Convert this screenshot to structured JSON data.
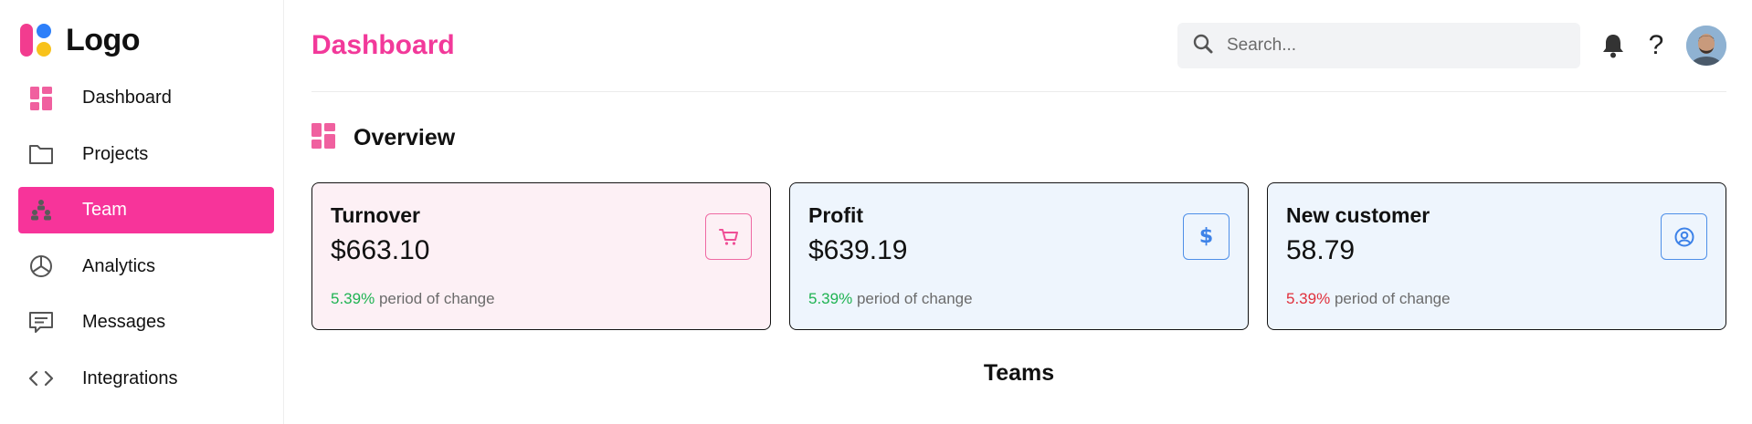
{
  "logo": {
    "text": "Logo"
  },
  "sidebar": {
    "items": [
      {
        "label": "Dashboard",
        "icon": "dashboard-icon",
        "active": false
      },
      {
        "label": "Projects",
        "icon": "folder-icon",
        "active": false
      },
      {
        "label": "Team",
        "icon": "team-icon",
        "active": true
      },
      {
        "label": "Analytics",
        "icon": "pie-chart-icon",
        "active": false
      },
      {
        "label": "Messages",
        "icon": "message-icon",
        "active": false
      },
      {
        "label": "Integrations",
        "icon": "code-icon",
        "active": false
      }
    ]
  },
  "header": {
    "title": "Dashboard",
    "search_placeholder": "Search...",
    "help_label": "?"
  },
  "overview": {
    "title": "Overview"
  },
  "cards": [
    {
      "title": "Turnover",
      "value": "$663.10",
      "change": "5.39%",
      "change_text": "period of change",
      "trend": "up",
      "icon": "cart-icon"
    },
    {
      "title": "Profit",
      "value": "$639.19",
      "change": "5.39%",
      "change_text": "period of change",
      "trend": "up",
      "icon": "dollar-icon",
      "icon_text": "$"
    },
    {
      "title": "New customer",
      "value": "58.79",
      "change": "5.39%",
      "change_text": "period of change",
      "trend": "down",
      "icon": "user-circle-icon"
    }
  ],
  "teams": {
    "title": "Teams"
  },
  "colors": {
    "accent": "#f7349a",
    "title": "#f2399a",
    "up": "#1fb352",
    "down": "#e0303c",
    "blue": "#3d82e8"
  }
}
